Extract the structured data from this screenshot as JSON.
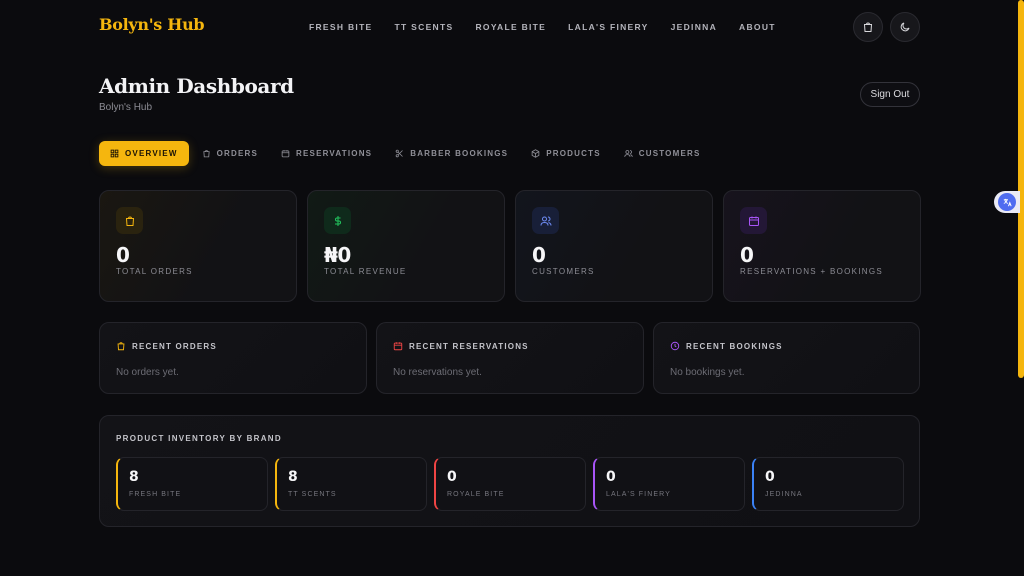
{
  "header": {
    "logo": "Bolyn's Hub",
    "nav": [
      "FRESH BITE",
      "TT SCENTS",
      "ROYALE BITE",
      "LALA'S FINERY",
      "JEDINNA",
      "ABOUT"
    ],
    "icons": [
      "bag-icon",
      "moon-icon"
    ]
  },
  "page": {
    "title": "Admin Dashboard",
    "subtitle": "Bolyn's Hub",
    "sign_out": "Sign Out"
  },
  "tabs": [
    {
      "label": "OVERVIEW",
      "icon": "grid-icon",
      "active": true
    },
    {
      "label": "ORDERS",
      "icon": "bag-icon"
    },
    {
      "label": "RESERVATIONS",
      "icon": "calendar-icon"
    },
    {
      "label": "BARBER BOOKINGS",
      "icon": "scissors-icon"
    },
    {
      "label": "PRODUCTS",
      "icon": "box-icon"
    },
    {
      "label": "CUSTOMERS",
      "icon": "users-icon"
    }
  ],
  "stats": [
    {
      "value": "0",
      "label": "TOTAL ORDERS",
      "icon": "bag-icon",
      "color": "#f5b60e"
    },
    {
      "value": "₦0",
      "label": "TOTAL REVENUE",
      "icon": "dollar-icon",
      "color": "#22c55e"
    },
    {
      "value": "0",
      "label": "CUSTOMERS",
      "icon": "users-icon",
      "color": "#6f8cf5"
    },
    {
      "value": "0",
      "label": "RESERVATIONS + BOOKINGS",
      "icon": "calendar-icon",
      "color": "#a855f7"
    }
  ],
  "recent": [
    {
      "title": "RECENT ORDERS",
      "empty": "No orders yet.",
      "icon": "bag-icon",
      "color": "#f5b60e"
    },
    {
      "title": "RECENT RESERVATIONS",
      "empty": "No reservations yet.",
      "icon": "calendar-icon",
      "color": "#ef4444"
    },
    {
      "title": "RECENT BOOKINGS",
      "empty": "No bookings yet.",
      "icon": "clock-icon",
      "color": "#a855f7"
    }
  ],
  "inventory": {
    "title": "PRODUCT INVENTORY BY BRAND",
    "brands": [
      {
        "count": "8",
        "name": "FRESH BITE",
        "color": "#f5b60e"
      },
      {
        "count": "8",
        "name": "TT SCENTS",
        "color": "#f5b60e"
      },
      {
        "count": "0",
        "name": "ROYALE BITE",
        "color": "#ef4444"
      },
      {
        "count": "0",
        "name": "LALA'S FINERY",
        "color": "#a855f7"
      },
      {
        "count": "0",
        "name": "JEDINNA",
        "color": "#3b82f6"
      }
    ]
  }
}
